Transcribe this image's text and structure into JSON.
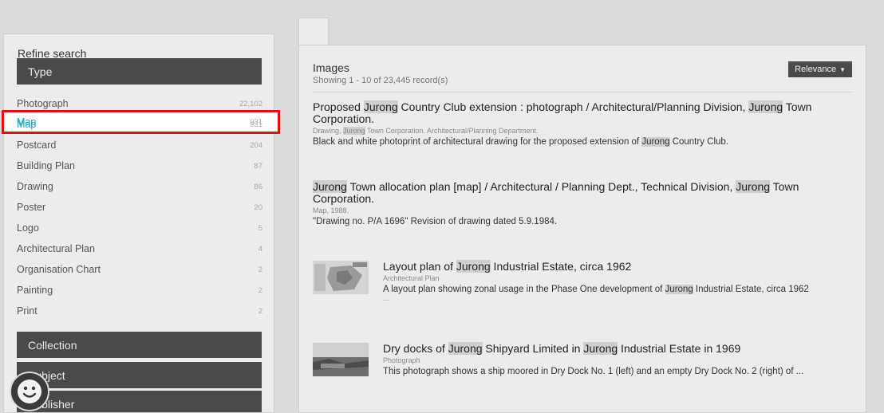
{
  "sidebar": {
    "refine_title": "Refine search",
    "type_header": "Type",
    "facets": [
      {
        "label": "Photograph",
        "count": "22,102"
      },
      {
        "label": "Map",
        "count": "931"
      },
      {
        "label": "Postcard",
        "count": "204"
      },
      {
        "label": "Building Plan",
        "count": "87"
      },
      {
        "label": "Drawing",
        "count": "86"
      },
      {
        "label": "Poster",
        "count": "20"
      },
      {
        "label": "Logo",
        "count": "5"
      },
      {
        "label": "Architectural Plan",
        "count": "4"
      },
      {
        "label": "Organisation Chart",
        "count": "2"
      },
      {
        "label": "Painting",
        "count": "2"
      },
      {
        "label": "Print",
        "count": "2"
      }
    ],
    "selected_facet": "Map",
    "collection_header": "Collection",
    "subject_header": "Subject",
    "publisher_header": "Publisher"
  },
  "results": {
    "title": "Images",
    "count_text": "Showing 1 - 10 of 23,445 record(s)",
    "sort_label": "Relevance",
    "items": [
      {
        "title": "Proposed Jurong Country Club extension : photograph / Architectural/Planning Division, Jurong Town Corporation.",
        "meta": "Drawing, Jurong Town Corporation. Architectural/Planning Department.",
        "desc": "Black and white photoprint of architectural drawing for the proposed extension of Jurong Country Club."
      },
      {
        "title": "Jurong Town allocation plan [map] / Architectural / Planning Dept., Technical Division, Jurong Town Corporation.",
        "meta": "Map, 1988.",
        "desc": "\"Drawing no. P/A 1696\" Revision of drawing dated 5.9.1984."
      },
      {
        "title": "Layout plan of Jurong Industrial Estate, circa 1962",
        "meta": "Architectural Plan",
        "desc": "A layout plan showing zonal usage in the Phase One development of Jurong Industrial Estate, circa 1962",
        "ellipsis": "..."
      },
      {
        "title": "Dry docks of Jurong Shipyard Limited in Jurong Industrial Estate in 1969",
        "meta": "Photograph",
        "desc": "This photograph shows a ship moored in Dry Dock No. 1 (left) and an empty Dry Dock No. 2 (right) of ..."
      }
    ]
  },
  "colors": {
    "selected_facet": "#1aa5c2",
    "highlight_box": "#e01010",
    "header_bg": "#4a4a4a"
  },
  "icons": {
    "sort_caret": "caret-down-icon",
    "chat": "smiley-face-icon"
  }
}
